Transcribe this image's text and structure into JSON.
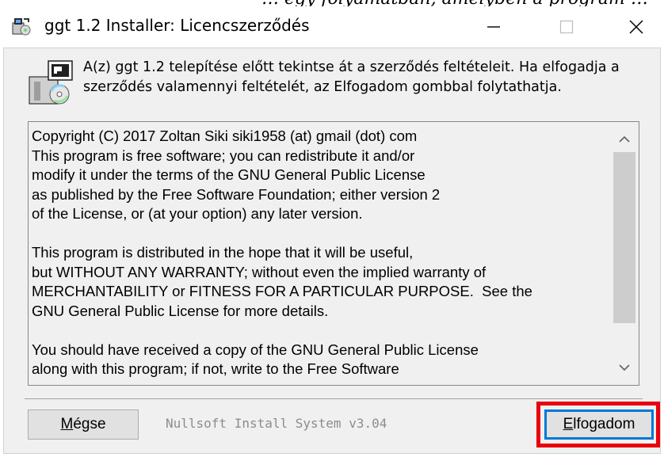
{
  "top_strip_text": "… egy folyamatban, amelyben a program …",
  "window": {
    "title": "ggt 1.2 Installer: Licencszerződés",
    "minimize_glyph": "—",
    "maximize_glyph": "☐",
    "close_glyph": "✕"
  },
  "header": {
    "description": "A(z) ggt 1.2 telepítése előtt tekintse át a szerződés feltételeit. Ha elfogadja a szerződés valamennyi feltételét, az Elfogadom gombbal folytathatja."
  },
  "license": {
    "text": "Copyright (C) 2017 Zoltan Siki siki1958 (at) gmail (dot) com\nThis program is free software; you can redistribute it and/or\nmodify it under the terms of the GNU General Public License\nas published by the Free Software Foundation; either version 2\nof the License, or (at your option) any later version.\n\nThis program is distributed in the hope that it will be useful,\nbut WITHOUT ANY WARRANTY; without even the implied warranty of\nMERCHANTABILITY or FITNESS FOR A PARTICULAR PURPOSE.  See the\nGNU General Public License for more details.\n\nYou should have received a copy of the GNU General Public License\nalong with this program; if not, write to the Free Software"
  },
  "footer": {
    "cancel_label_mnemonic": "M",
    "cancel_label_rest": "égse",
    "branding": "Nullsoft Install System v3.04",
    "accept_label_mnemonic": "E",
    "accept_label_rest": "lfogadom"
  },
  "icons": {
    "app": "installer-icon",
    "header": "installer-box-icon",
    "scroll_up": "chevron-up-icon",
    "scroll_down": "chevron-down-icon"
  },
  "colors": {
    "highlight": "#e8000f",
    "default_button_border": "#0078d7",
    "dialog_bg": "#f0f0f0"
  }
}
